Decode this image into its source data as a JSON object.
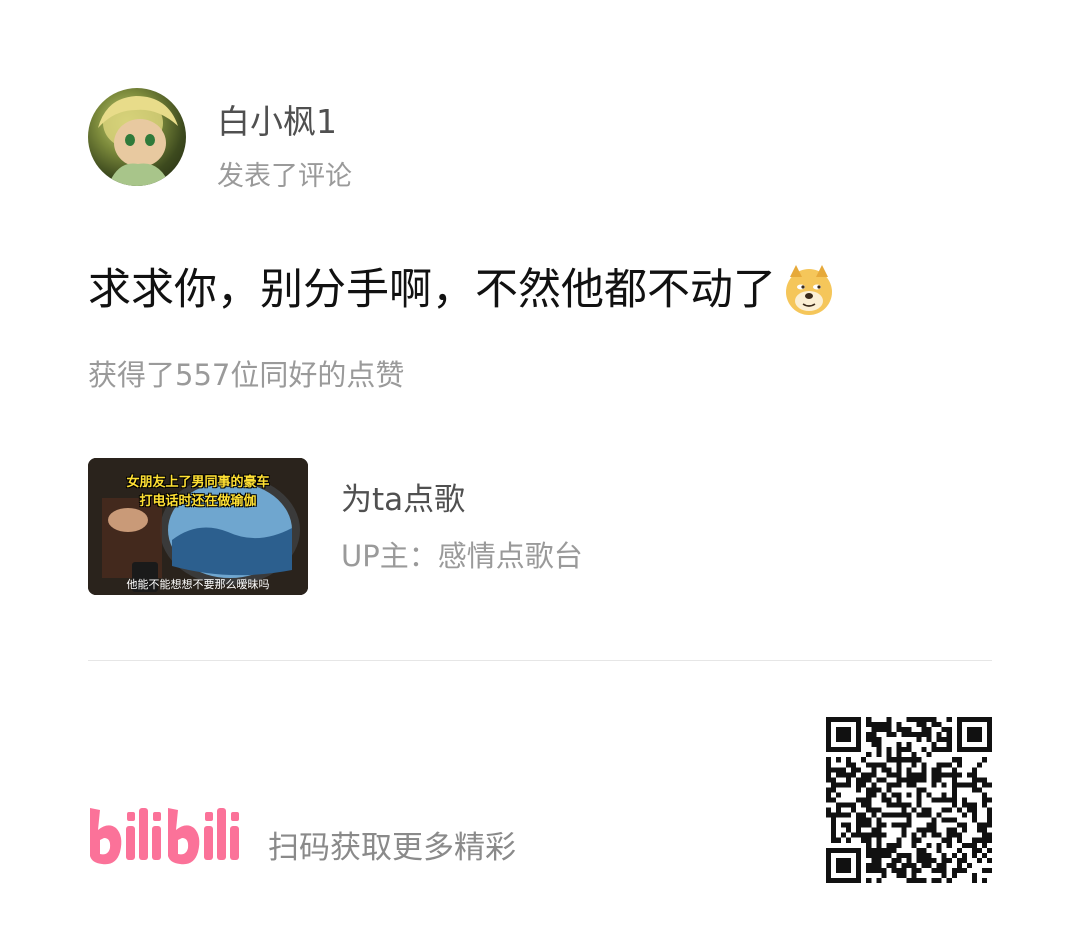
{
  "user": {
    "name": "白小枫1",
    "action": "发表了评论"
  },
  "comment": {
    "text": "求求你，别分手啊，不然他都不动了",
    "emoji": "doge-icon"
  },
  "likes_text": "获得了557位同好的点赞",
  "video": {
    "thumbnail_caption_line1": "女朋友上了男同事的豪车",
    "thumbnail_caption_line2": "打电话时还在做瑜伽",
    "thumbnail_subtitle": "他能不能想想不要那么暧昧吗",
    "title": "为ta点歌",
    "uploader": "UP主：感情点歌台"
  },
  "footer": {
    "logo_text": "bilibili",
    "scan_text": "扫码获取更多精彩"
  },
  "colors": {
    "bilibili_pink": "#fb7299",
    "text_dark": "#111111",
    "text_gray": "#9a9a9a"
  }
}
